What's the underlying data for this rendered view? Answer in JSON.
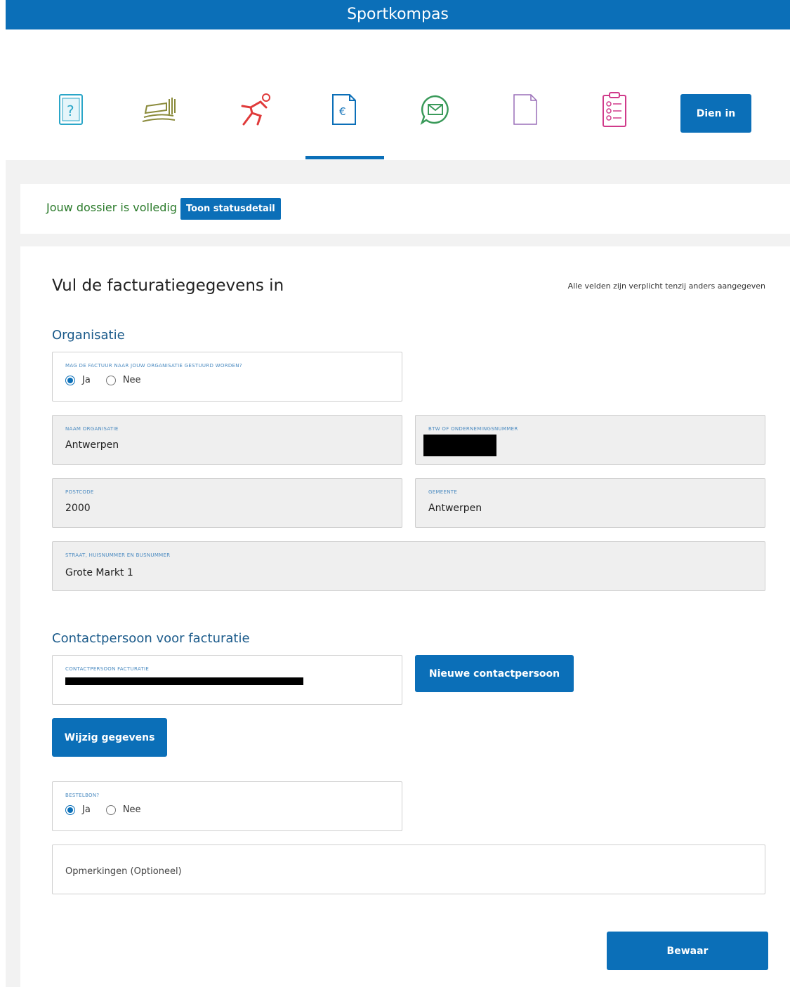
{
  "app": {
    "title": "Sportkompas"
  },
  "steps": {
    "items": [
      {
        "icon": "question-document-icon",
        "color": "#2aa6c8"
      },
      {
        "icon": "track-field-icon",
        "color": "#8a8a3a"
      },
      {
        "icon": "runner-icon",
        "color": "#e03a3a"
      },
      {
        "icon": "invoice-euro-icon",
        "color": "#0b6fb8",
        "active": true
      },
      {
        "icon": "chat-mail-icon",
        "color": "#3a9a5a"
      },
      {
        "icon": "blank-document-icon",
        "color": "#9a6fb8"
      },
      {
        "icon": "checklist-clipboard-icon",
        "color": "#d03a8a"
      }
    ],
    "submit_label": "Dien in"
  },
  "status": {
    "text": "Jouw dossier is volledig",
    "button_label": "Toon statusdetail"
  },
  "form": {
    "title": "Vul de facturatiegegevens in",
    "required_note": "Alle velden zijn verplicht tenzij anders aangegeven",
    "organisation_heading": "Organisatie",
    "send_to_org": {
      "label": "Mag de factuur naar jouw organisatie gestuurd worden?",
      "options": [
        "Ja",
        "Nee"
      ],
      "selected": "Ja"
    },
    "org_name": {
      "label": "Naam organisatie",
      "value": "Antwerpen"
    },
    "vat_number": {
      "label": "BTW of ondernemingsnummer",
      "value": ""
    },
    "postcode": {
      "label": "Postcode",
      "value": "2000"
    },
    "municipality": {
      "label": "Gemeente",
      "value": "Antwerpen"
    },
    "street": {
      "label": "Straat, huisnummer en busnummer",
      "value": "Grote Markt 1"
    },
    "contact_heading": "Contactpersoon voor facturatie",
    "contact_person": {
      "label": "Contactpersoon facturatie",
      "value": ""
    },
    "new_contact_label": "Nieuwe contactpersoon",
    "edit_label": "Wijzig gegevens",
    "order_form": {
      "label": "Bestelbon?",
      "options": [
        "Ja",
        "Nee"
      ],
      "selected": "Ja"
    },
    "remarks_placeholder": "Opmerkingen (Optioneel)",
    "save_label": "Bewaar"
  }
}
